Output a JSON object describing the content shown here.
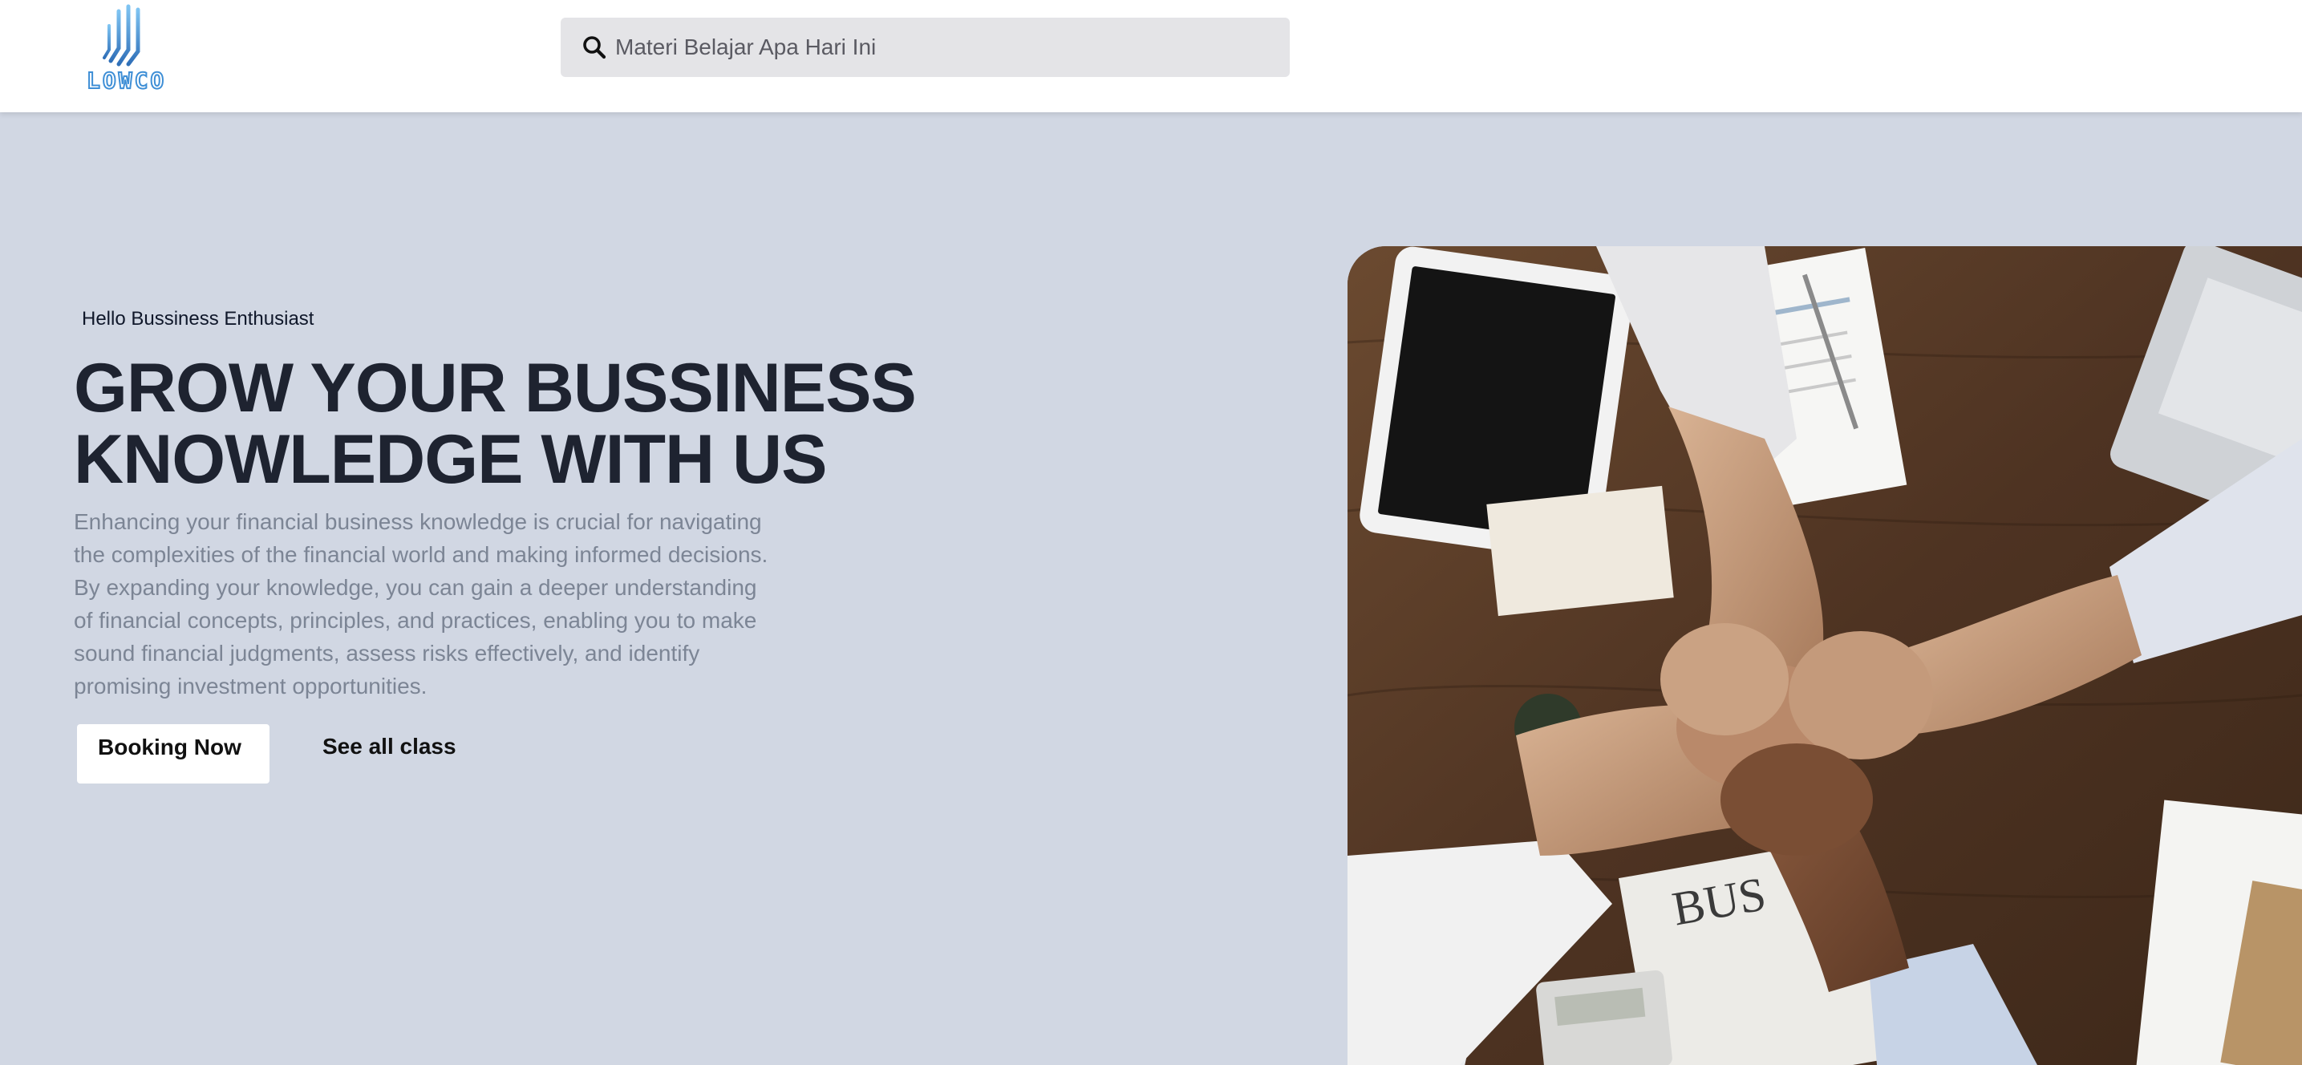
{
  "header": {
    "logo_text": "LOWCO",
    "search": {
      "placeholder": "Materi Belajar Apa Hari Ini"
    }
  },
  "hero": {
    "greeting": "Hello Bussiness Enthusiast",
    "headline_line1": "GROW YOUR BUSSINESS",
    "headline_line2": "KNOWLEDGE WITH US",
    "description": "Enhancing your financial business knowledge is crucial for navigating the complexities of the financial world and making informed decisions. By expanding your knowledge, you can gain a deeper understanding of financial concepts, principles, and practices, enabling you to make sound financial judgments, assess risks effectively, and identify promising investment opportunities.",
    "primary_button": "Booking Now",
    "secondary_link": "See all class"
  },
  "colors": {
    "background": "#d1d7e3",
    "header": "#ffffff",
    "search_bg": "#e4e4e7",
    "headline": "#1e2330",
    "body_text": "#7c8595",
    "logo_accent": "#3f8fd6"
  }
}
